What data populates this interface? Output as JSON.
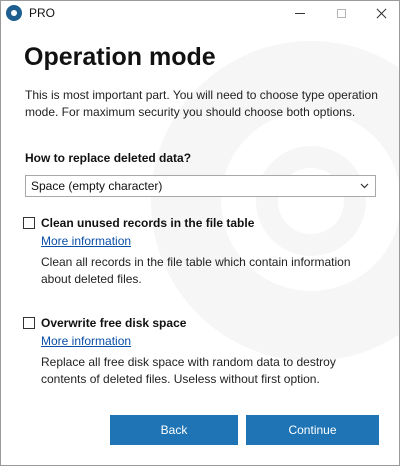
{
  "window": {
    "title": "PRO"
  },
  "page": {
    "heading": "Operation mode",
    "intro_lines": [
      "This is most important part. You will need to choose type operation",
      "mode. For maximum security you should choose both options."
    ]
  },
  "replace": {
    "question": "How to replace deleted data?",
    "selected": "Space (empty character)"
  },
  "options": [
    {
      "label": "Clean unused records in the file table",
      "checked": false,
      "link": "More information",
      "desc_lines": [
        "Clean all records in the file table which contain information",
        "about deleted files."
      ]
    },
    {
      "label": "Overwrite free disk space",
      "checked": false,
      "link": "More information",
      "desc_lines": [
        "Replace all free disk space with random data to destroy",
        "contents of deleted files. Useless without first option."
      ]
    }
  ],
  "buttons": {
    "back": "Back",
    "continue": "Continue"
  },
  "colors": {
    "accent": "#1f74b5",
    "link": "#0b4fa8",
    "app_icon": "#1f5f8f"
  },
  "icons": {
    "app": "disc-icon",
    "minimize": "minimize-icon",
    "maximize": "maximize-icon",
    "close": "close-icon",
    "dropdown": "chevron-down-icon"
  }
}
